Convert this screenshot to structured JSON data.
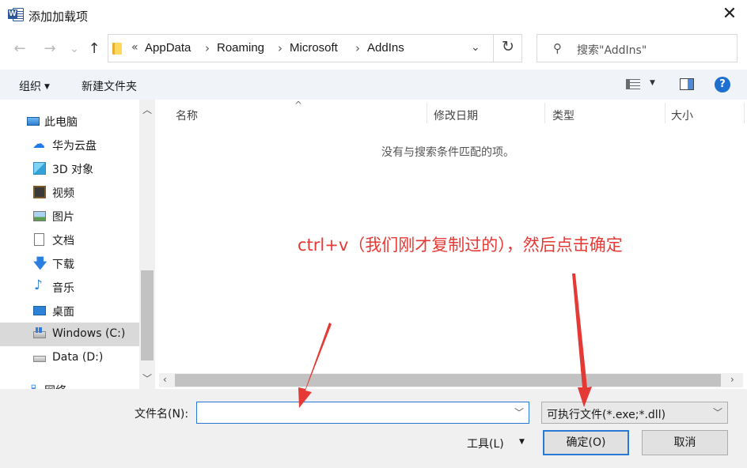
{
  "window": {
    "title": "添加加载项",
    "close": "✕"
  },
  "nav": {
    "back": "←",
    "forward": "→",
    "recent": "⌄",
    "up": "↑",
    "breadcrumbs": [
      "AppData",
      "Roaming",
      "Microsoft",
      "AddIns"
    ],
    "overflow": "«",
    "separator": "›",
    "refresh": "↻",
    "dropdown": "⌄",
    "search_placeholder": "搜索\"AddIns\""
  },
  "toolbar": {
    "organize": "组织",
    "new_folder": "新建文件夹",
    "help": "?"
  },
  "sidebar": {
    "items": [
      {
        "label": "此电脑",
        "icon": "computer-icon"
      },
      {
        "label": "华为云盘",
        "icon": "cloud-icon"
      },
      {
        "label": "3D 对象",
        "icon": "cube-3d-icon"
      },
      {
        "label": "视频",
        "icon": "video-icon"
      },
      {
        "label": "图片",
        "icon": "pictures-icon"
      },
      {
        "label": "文档",
        "icon": "document-icon"
      },
      {
        "label": "下载",
        "icon": "download-icon"
      },
      {
        "label": "音乐",
        "icon": "music-icon"
      },
      {
        "label": "桌面",
        "icon": "desktop-icon"
      },
      {
        "label": "Windows (C:)",
        "icon": "windows-drive-icon",
        "selected": true
      },
      {
        "label": "Data (D:)",
        "icon": "drive-icon"
      },
      {
        "label": "网络",
        "icon": "network-icon"
      }
    ]
  },
  "columns": [
    "名称",
    "修改日期",
    "类型",
    "大小"
  ],
  "empty_message": "没有与搜索条件匹配的项。",
  "annotation": "ctrl+v（我们刚才复制过的），然后点击确定",
  "annotation_color": "#e53935",
  "footer": {
    "filename_label": "文件名(N):",
    "filename_value": "",
    "filetype_value": "可执行文件(*.exe;*.dll)",
    "tools_label": "工具(L)",
    "ok_label": "确定(O)",
    "cancel_label": "取消"
  }
}
